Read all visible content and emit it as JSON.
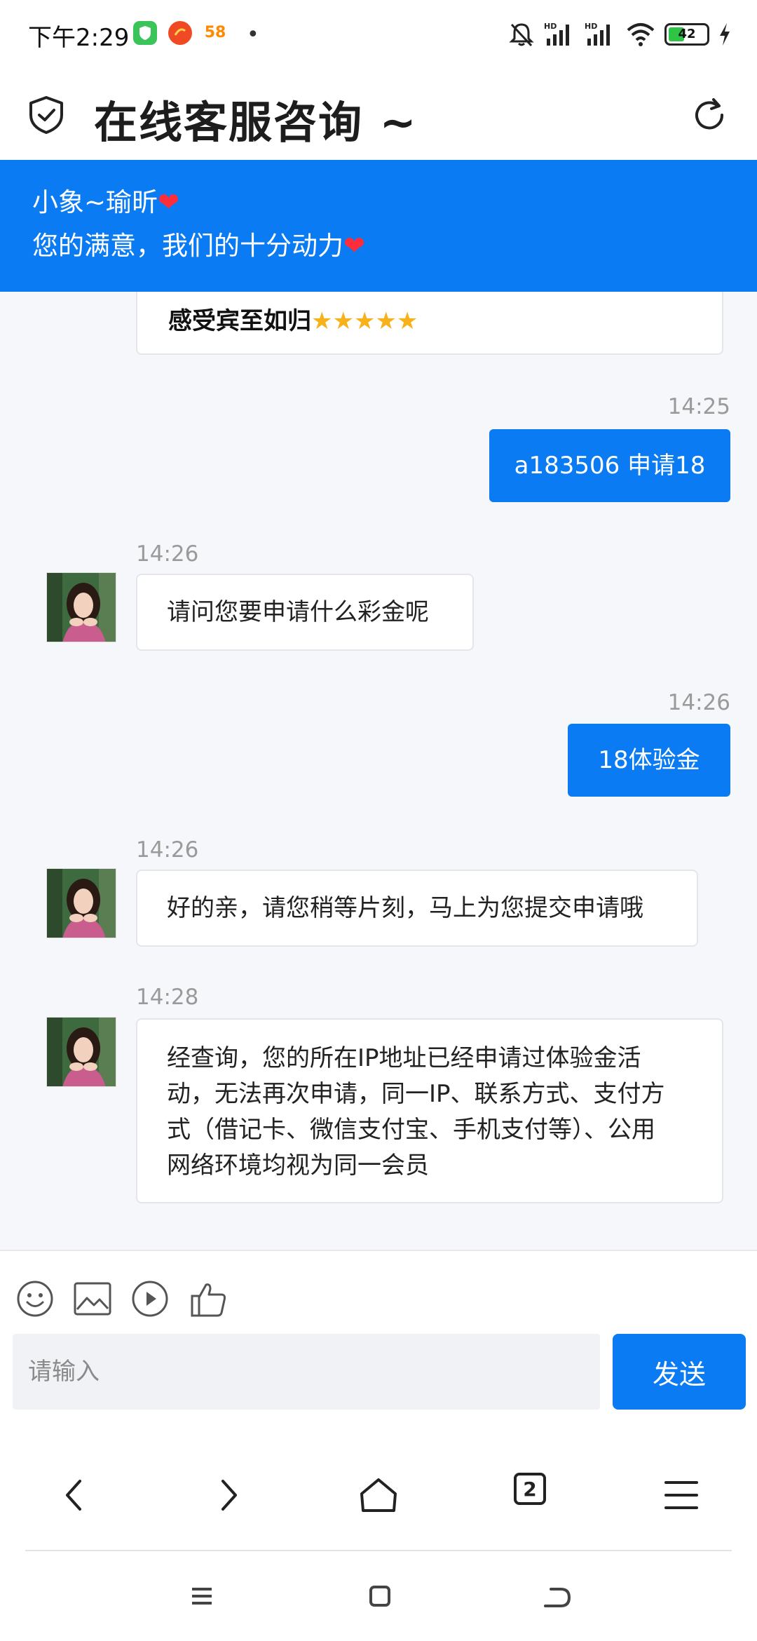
{
  "status_bar": {
    "time": "下午2:29",
    "app_icons": [
      "shield-app-icon",
      "app-icon-red",
      "58-app-icon"
    ],
    "app_58_text": "58",
    "battery_level": "42",
    "battery_percent": 42,
    "indicators": [
      "mute-icon",
      "hd-signal-1-icon",
      "hd-signal-2-icon",
      "wifi-icon",
      "battery-icon",
      "charging-icon"
    ]
  },
  "header": {
    "title": "在线客服咨询 ~"
  },
  "banner": {
    "line1": "小象~瑜昕",
    "line2": "您的满意，我们的十分动力",
    "heart": "❤"
  },
  "chat": {
    "previous_message_tail": "感受宾至如归",
    "previous_message_stars": "★★★★★",
    "messages": [
      {
        "from": "user",
        "time": "14:25",
        "text": "a183506 申请18"
      },
      {
        "from": "agent",
        "time": "14:26",
        "text": "请问您要申请什么彩金呢"
      },
      {
        "from": "user",
        "time": "14:26",
        "text": "18体验金"
      },
      {
        "from": "agent",
        "time": "14:26",
        "text": "好的亲，请您稍等片刻，马上为您提交申请哦"
      },
      {
        "from": "agent",
        "time": "14:28",
        "lines": [
          "经查询，您的所在IP地址已经申请过体验金活",
          "动，无法再次申请，同一IP、联系方式、支付方",
          "式（借记卡、微信支付宝、手机支付等）、公用",
          "网络环境均视为同一会员"
        ]
      }
    ]
  },
  "input": {
    "placeholder": "请输入",
    "send_label": "发送",
    "tools": [
      "emoji-icon",
      "image-icon",
      "video-icon",
      "thumbs-up-icon"
    ]
  },
  "browser_nav": {
    "tab_count": "2",
    "buttons": [
      "back-icon",
      "forward-icon",
      "home-icon",
      "tabs-icon",
      "menu-icon"
    ]
  },
  "system_nav": {
    "buttons": [
      "recent-apps-icon",
      "home-square-icon",
      "back-gesture-icon"
    ]
  },
  "colors": {
    "accent": "#0a7bf3",
    "chat_background": "#f6f7fa",
    "heart": "#ff2d3a",
    "star": "#f6b11b"
  }
}
